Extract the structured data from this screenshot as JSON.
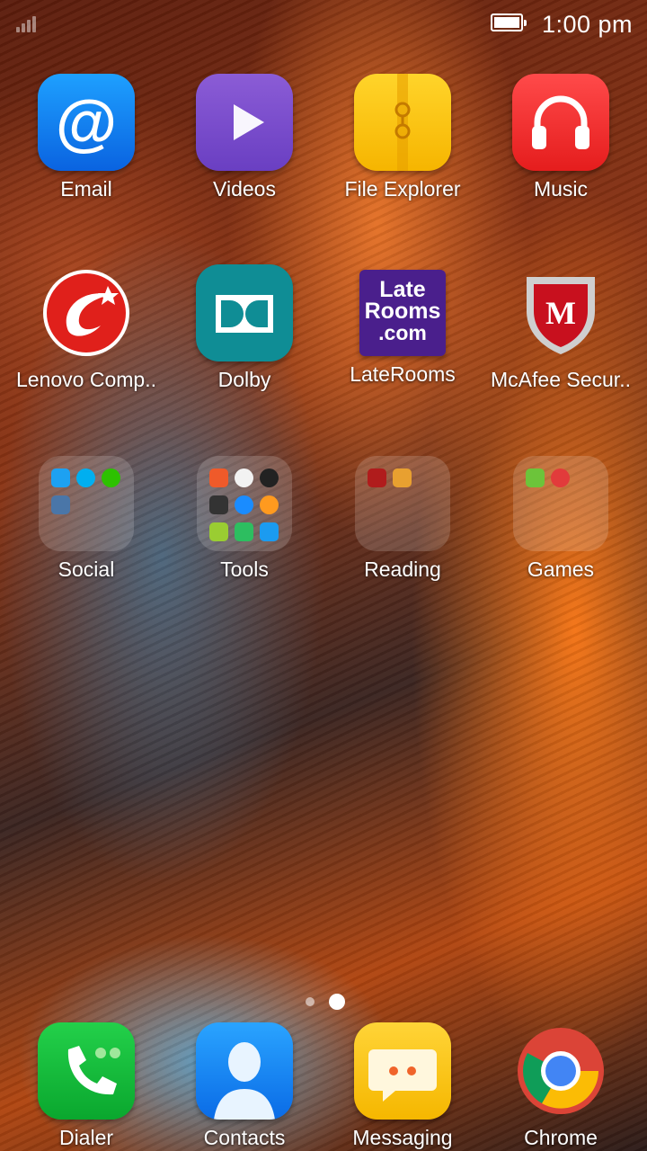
{
  "status_bar": {
    "time": "1:00 pm",
    "battery_level": 1.0
  },
  "apps": [
    {
      "label": "Email",
      "icon": "email-at-icon"
    },
    {
      "label": "Videos",
      "icon": "play-icon"
    },
    {
      "label": "File Explorer",
      "icon": "folder-clip-icon"
    },
    {
      "label": "Music",
      "icon": "headphones-icon"
    },
    {
      "label": "Lenovo Comp..",
      "icon": "lenovo-companion-icon"
    },
    {
      "label": "Dolby",
      "icon": "dolby-icon"
    },
    {
      "label": "LateRooms",
      "icon": "laterooms-icon",
      "logo_text": [
        "Late",
        "Rooms",
        ".com"
      ]
    },
    {
      "label": "McAfee Secur..",
      "icon": "mcafee-shield-icon",
      "logo_text": "M"
    }
  ],
  "folders": [
    {
      "label": "Social",
      "apps": [
        "twitter-icon",
        "skype-icon",
        "wechat-icon",
        "vk-icon"
      ]
    },
    {
      "label": "Tools",
      "apps": [
        "calculator-icon",
        "robot-icon",
        "clock-icon",
        "flashlight-icon",
        "compass-icon",
        "uc-browser-icon",
        "flipboard-icon",
        "evernote-icon",
        "truecaller-icon"
      ]
    },
    {
      "label": "Reading",
      "apps": [
        "book-icon",
        "reader-icon"
      ]
    },
    {
      "label": "Games",
      "apps": [
        "frog-game-icon",
        "gamestore-icon"
      ]
    }
  ],
  "page_indicator": {
    "pages": 2,
    "current": 2
  },
  "dock": [
    {
      "label": "Dialer",
      "icon": "phone-icon"
    },
    {
      "label": "Contacts",
      "icon": "contact-person-icon"
    },
    {
      "label": "Messaging",
      "icon": "message-bubble-icon"
    },
    {
      "label": "Chrome",
      "icon": "chrome-icon"
    }
  ]
}
